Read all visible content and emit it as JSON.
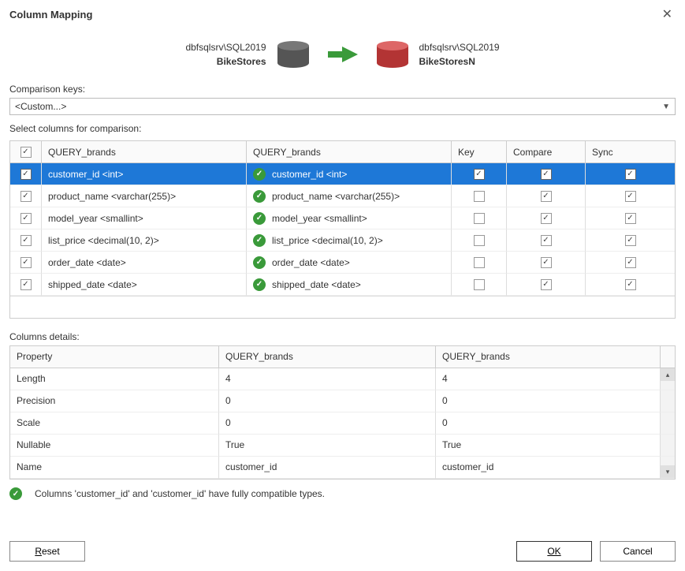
{
  "dialog": {
    "title": "Column Mapping"
  },
  "source": {
    "server": "dbfsqlsrv\\SQL2019",
    "database": "BikeStores"
  },
  "target": {
    "server": "dbfsqlsrv\\SQL2019",
    "database": "BikeStoresN"
  },
  "labels": {
    "comparison_keys": "Comparison keys:",
    "select_columns": "Select columns for comparison:",
    "columns_details": "Columns details:"
  },
  "combo": {
    "value": "<Custom...>"
  },
  "columns_table": {
    "headers": {
      "left": "QUERY_brands",
      "right": "QUERY_brands",
      "key": "Key",
      "compare": "Compare",
      "sync": "Sync"
    },
    "rows": [
      {
        "left": "customer_id <int>",
        "right": "customer_id <int>",
        "checked": true,
        "key": true,
        "compare": true,
        "sync": true,
        "selected": true
      },
      {
        "left": "product_name <varchar(255)>",
        "right": "product_name <varchar(255)>",
        "checked": true,
        "key": false,
        "compare": true,
        "sync": true,
        "selected": false
      },
      {
        "left": "model_year <smallint>",
        "right": "model_year <smallint>",
        "checked": true,
        "key": false,
        "compare": true,
        "sync": true,
        "selected": false
      },
      {
        "left": "list_price <decimal(10, 2)>",
        "right": "list_price <decimal(10, 2)>",
        "checked": true,
        "key": false,
        "compare": true,
        "sync": true,
        "selected": false
      },
      {
        "left": "order_date <date>",
        "right": "order_date <date>",
        "checked": true,
        "key": false,
        "compare": true,
        "sync": true,
        "selected": false
      },
      {
        "left": "shipped_date <date>",
        "right": "shipped_date <date>",
        "checked": true,
        "key": false,
        "compare": true,
        "sync": true,
        "selected": false
      }
    ]
  },
  "details_table": {
    "headers": {
      "property": "Property",
      "left": "QUERY_brands",
      "right": "QUERY_brands"
    },
    "rows": [
      {
        "property": "Length",
        "left": "4",
        "right": "4"
      },
      {
        "property": "Precision",
        "left": "0",
        "right": "0"
      },
      {
        "property": "Scale",
        "left": "0",
        "right": "0"
      },
      {
        "property": "Nullable",
        "left": "True",
        "right": "True"
      },
      {
        "property": "Name",
        "left": "customer_id",
        "right": "customer_id"
      }
    ]
  },
  "status": {
    "message": "Columns 'customer_id' and 'customer_id' have fully compatible types."
  },
  "buttons": {
    "reset": "Reset",
    "ok": "OK",
    "cancel": "Cancel"
  }
}
